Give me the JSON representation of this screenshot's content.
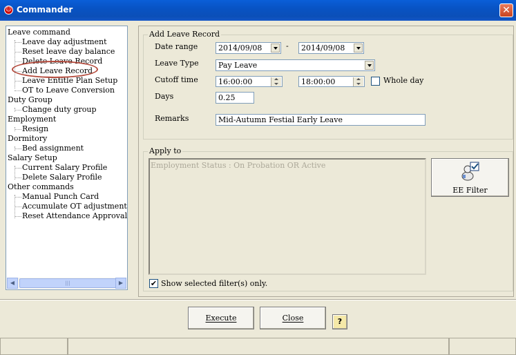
{
  "window": {
    "title": "Commander",
    "close_glyph": "✕"
  },
  "tree": {
    "items": [
      {
        "label": "Leave command",
        "level": 0
      },
      {
        "label": "Leave day adjustment",
        "level": 1
      },
      {
        "label": "Reset leave day balance",
        "level": 1
      },
      {
        "label": "Delete Leave Record",
        "level": 1
      },
      {
        "label": "Add Leave Record",
        "level": 1
      },
      {
        "label": "Leave Entitle Plan Setup",
        "level": 1
      },
      {
        "label": "OT to Leave Conversion",
        "level": 1
      },
      {
        "label": "Duty Group",
        "level": 0
      },
      {
        "label": "Change duty group",
        "level": 1
      },
      {
        "label": "Employment",
        "level": 0
      },
      {
        "label": "Resign",
        "level": 1
      },
      {
        "label": "Dormitory",
        "level": 0
      },
      {
        "label": "Bed assignment",
        "level": 1
      },
      {
        "label": "Salary Setup",
        "level": 0
      },
      {
        "label": "Current Salary Profile",
        "level": 1
      },
      {
        "label": "Delete Salary Profile",
        "level": 1
      },
      {
        "label": "Other commands",
        "level": 0
      },
      {
        "label": "Manual Punch Card",
        "level": 1
      },
      {
        "label": "Accumulate OT adjustment",
        "level": 1
      },
      {
        "label": "Reset Attendance Approval Leve",
        "level": 1
      }
    ],
    "scroll_left": "◀",
    "scroll_right": "▶",
    "thumb_grip": "|||"
  },
  "add_leave": {
    "group_title": "Add Leave Record",
    "date_range_label": "Date range",
    "date_from": "2014/09/08",
    "date_separator": "-",
    "date_to": "2014/09/08",
    "leave_type_label": "Leave Type",
    "leave_type": "Pay Leave",
    "cutoff_label": "Cutoff time",
    "cutoff_from": "16:00:00",
    "cutoff_to": "18:00:00",
    "whole_day_label": "Whole day",
    "whole_day_checked": false,
    "days_label": "Days",
    "days_value": "0.25",
    "remarks_label": "Remarks",
    "remarks_value": "Mid-Autumn Festial Early Leave"
  },
  "apply_to": {
    "group_title": "Apply to",
    "filter_text": "Employment Status : On Probation OR Active",
    "ee_filter_label": "EE Filter",
    "show_selected_label": "Show selected filter(s) only.",
    "show_selected_checked": true
  },
  "buttons": {
    "execute": "Execute",
    "close": "Close",
    "help_glyph": "?"
  },
  "icons": {
    "app": "app-icon",
    "filter": "filter-user-icon",
    "help": "help-icon"
  }
}
